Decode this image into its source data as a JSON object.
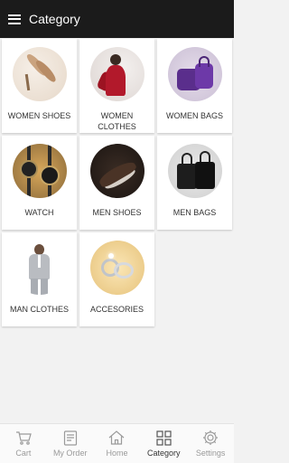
{
  "appbar": {
    "menu_icon": "hamburger-menu-icon",
    "title": "Category"
  },
  "categories": [
    {
      "label": "WOMEN SHOES",
      "image": "women-shoes-photo"
    },
    {
      "label": "WOMEN CLOTHES",
      "image": "women-clothes-photo"
    },
    {
      "label": "WOMEN BAGS",
      "image": "women-bags-photo"
    },
    {
      "label": "WATCH",
      "image": "watch-photo"
    },
    {
      "label": "MEN SHOES",
      "image": "men-shoes-photo"
    },
    {
      "label": "MEN BAGS",
      "image": "men-bags-photo"
    },
    {
      "label": "MAN CLOTHES",
      "image": "man-clothes-photo"
    },
    {
      "label": "ACCESORIES",
      "image": "accesories-photo"
    }
  ],
  "bottom_nav": {
    "active": "Category",
    "items": [
      {
        "label": "Cart",
        "icon": "cart-icon"
      },
      {
        "label": "My Order",
        "icon": "order-list-icon"
      },
      {
        "label": "Home",
        "icon": "home-icon"
      },
      {
        "label": "Category",
        "icon": "grid-icon"
      },
      {
        "label": "Settings",
        "icon": "gear-icon"
      }
    ]
  },
  "colors": {
    "appbar": "#1b1b1b",
    "background": "#f2f2f2",
    "tile": "#ffffff",
    "nav_inactive": "#9a9a9a",
    "nav_active": "#333333"
  }
}
